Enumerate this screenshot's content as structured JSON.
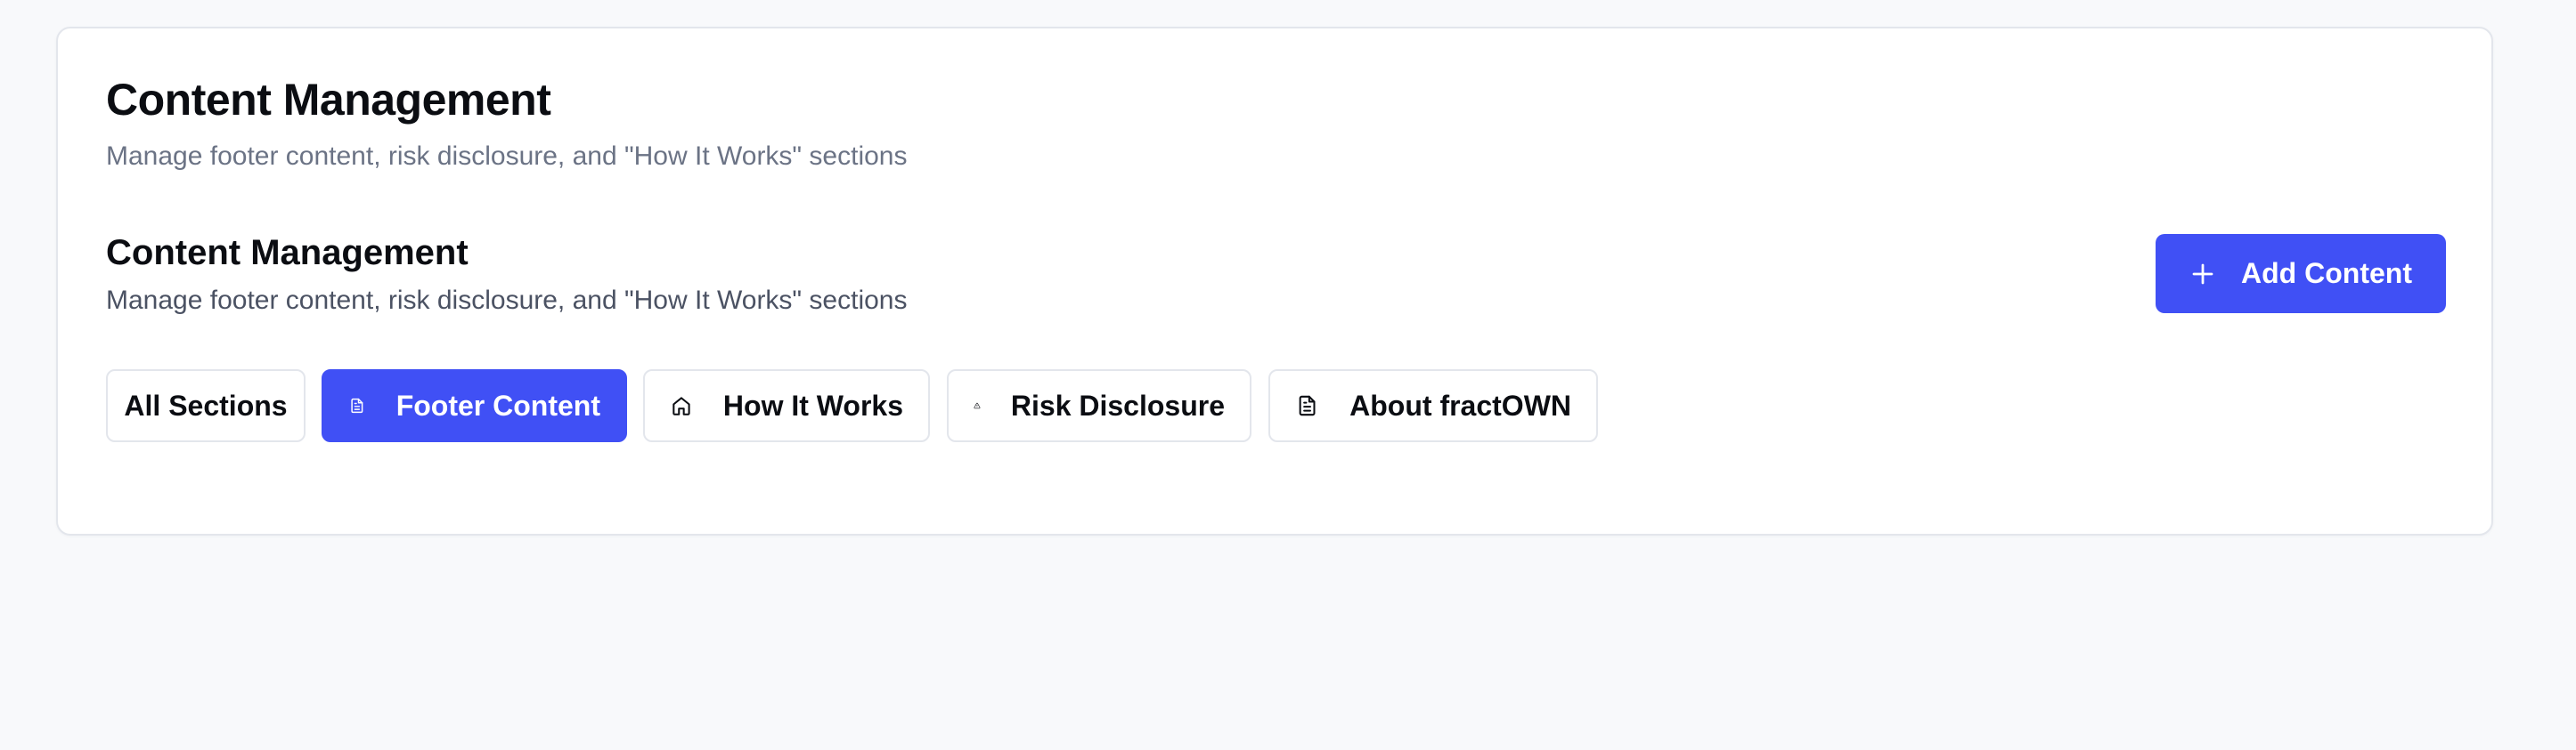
{
  "header": {
    "title": "Content Management",
    "subtitle": "Manage footer content, risk disclosure, and \"How It Works\" sections"
  },
  "section": {
    "title": "Content Management",
    "subtitle": "Manage footer content, risk disclosure, and \"How It Works\" sections",
    "add_button_label": "Add Content",
    "add_button_icon": "plus-icon"
  },
  "tabs": [
    {
      "label": "All Sections",
      "icon": null,
      "active": false
    },
    {
      "label": "Footer Content",
      "icon": "file-text-icon",
      "active": true
    },
    {
      "label": "How It Works",
      "icon": "home-icon",
      "active": false
    },
    {
      "label": "Risk Disclosure",
      "icon": "alert-triangle-icon",
      "active": false
    },
    {
      "label": "About fractOWN",
      "icon": "file-text-icon",
      "active": false
    }
  ],
  "colors": {
    "accent": "#4050f5",
    "page_background": "#f8f9fb",
    "card_background": "#ffffff",
    "muted_text": "#6b7385"
  }
}
